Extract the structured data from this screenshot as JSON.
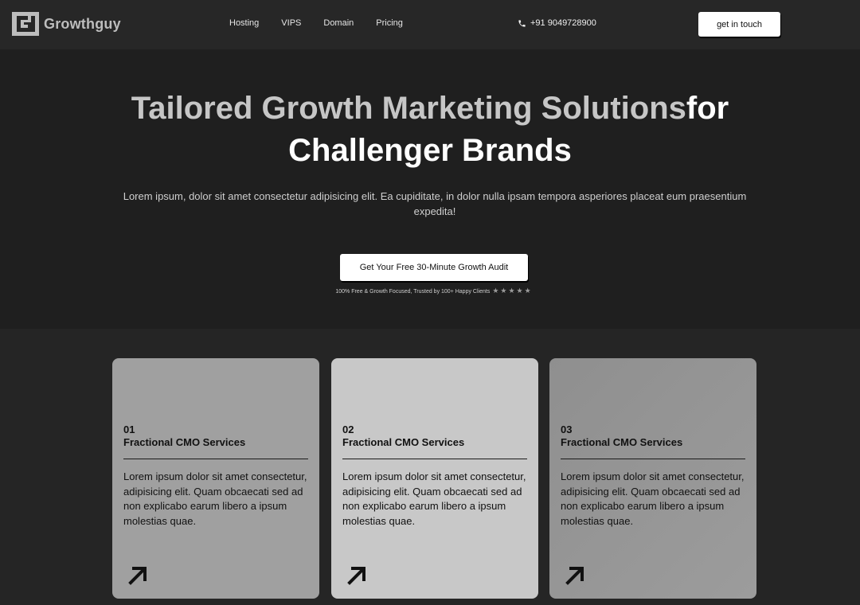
{
  "nav": {
    "logo_text": "Growthguy",
    "links": [
      "Hosting",
      "VIPS",
      "Domain",
      "Pricing"
    ],
    "phone": "+91 9049728900",
    "cta": "get in touch"
  },
  "hero": {
    "headline_muted": "Tailored Growth Marketing Solutions",
    "headline_strong_1": "for",
    "headline_strong_2": "Challenger Brands",
    "subtitle": "Lorem ipsum, dolor sit amet consectetur adipisicing elit. Ea cupiditate, in dolor nulla ipsam tempora asperiores placeat eum praesentium expedita!",
    "cta": "Get Your Free 30-Minute Growth Audit",
    "trust_text": "100% Free & Growth Focused, Trusted by 100+ Happy Clients",
    "stars": "★★★★★"
  },
  "cards": [
    {
      "num": "01",
      "title": "Fractional CMO Services",
      "desc": "Lorem ipsum dolor sit amet consectetur, adipisicing elit. Quam obcaecati sed ad non explicabo earum libero a ipsum molestias quae.",
      "icon": "arrow-up-right-icon"
    },
    {
      "num": "02",
      "title": "Fractional CMO Services",
      "desc": "Lorem ipsum dolor sit amet consectetur, adipisicing elit. Quam obcaecati sed ad non explicabo earum libero a ipsum molestias quae.",
      "icon": "arrow-up-right-icon"
    },
    {
      "num": "03",
      "title": "Fractional CMO Services",
      "desc": "Lorem ipsum dolor sit amet consectetur, adipisicing elit. Quam obcaecati sed ad non explicabo earum libero a ipsum molestias quae.",
      "icon": "arrow-up-right-icon"
    }
  ],
  "colors": {
    "background": "#1f1f1f",
    "nav_background": "#272727",
    "card1": "#a0a0a0",
    "card2": "#c8c8c8",
    "card3": "#959595"
  }
}
